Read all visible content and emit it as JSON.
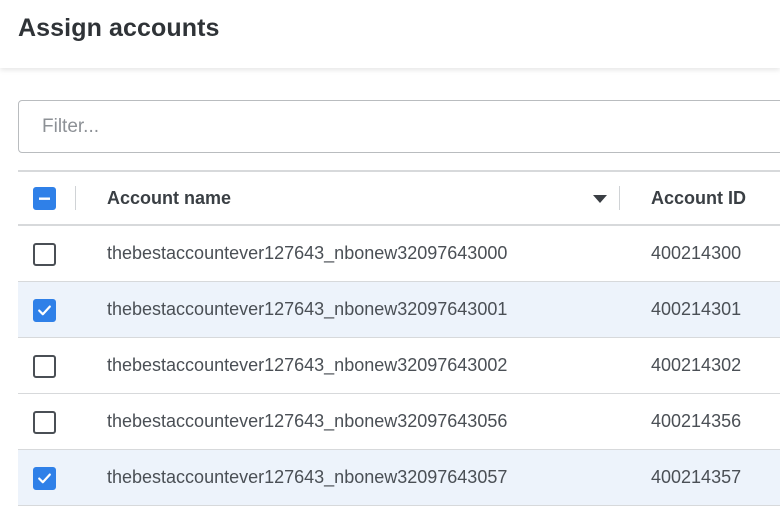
{
  "header": {
    "title": "Assign accounts"
  },
  "filter": {
    "placeholder": "Filter..."
  },
  "table": {
    "columns": {
      "name": "Account name",
      "id": "Account ID"
    },
    "select_all_state": "mixed",
    "rows": [
      {
        "name": "thebestaccountever127643_nbonew32097643000",
        "id": "400214300",
        "checked": false
      },
      {
        "name": "thebestaccountever127643_nbonew32097643001",
        "id": "400214301",
        "checked": true
      },
      {
        "name": "thebestaccountever127643_nbonew32097643002",
        "id": "400214302",
        "checked": false
      },
      {
        "name": "thebestaccountever127643_nbonew32097643056",
        "id": "400214356",
        "checked": false
      },
      {
        "name": "thebestaccountever127643_nbonew32097643057",
        "id": "400214357",
        "checked": true
      }
    ]
  },
  "colors": {
    "accent": "#2f80e8",
    "selected_row": "#edf3fb"
  },
  "icons": {
    "select_all": "minus-icon",
    "row_checked": "check-icon",
    "sort": "caret-down-icon"
  }
}
